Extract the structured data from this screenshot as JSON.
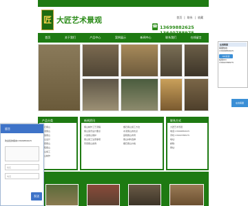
{
  "header": {
    "logo_text": "匠",
    "brand": "大匠艺术景观",
    "toplinks": [
      "首页",
      "|",
      "联系",
      "|",
      "收藏"
    ],
    "phone": "13699882625 13640788975"
  },
  "nav": [
    "首页",
    "关于我们",
    "产品中心",
    "案例展示",
    "新闻中心",
    "联系我们",
    "在线留言"
  ],
  "side_tab": {
    "title": "在线客服",
    "lines": [
      "客服热线",
      "13699882625",
      "在线QQ",
      "13640788975"
    ],
    "qq_label": "QQ交谈"
  },
  "bottom_float": "在线客服",
  "sections": {
    "left_title": "产品分类",
    "left_items": [
      "塑石假山",
      "水泥假山",
      "人造假山",
      "假山设计",
      "景观假山",
      "庭院假山",
      "假山施工",
      "假山制作"
    ],
    "middle_title": "新闻资讯",
    "middle_items": [
      "假山制作工艺流程",
      "塑石假山施工方法",
      "假山造景设计要点",
      "水泥假山的优点",
      "人造假山维护",
      "庭院假山布局",
      "假山施工注意事项",
      "假山材料选择",
      "景观假山案例",
      "塑石假山价格"
    ],
    "right_title": "联系方式",
    "right_items": [
      "大匠艺术景观",
      "电话:13699882625",
      "手机:13640788975",
      "地址:",
      "邮箱:",
      "网址:"
    ]
  },
  "overlay": {
    "title": "留言",
    "line": "欢迎您的留言13699882625",
    "name_placeholder": "姓名",
    "phone_placeholder": "电话",
    "send": "发送"
  }
}
